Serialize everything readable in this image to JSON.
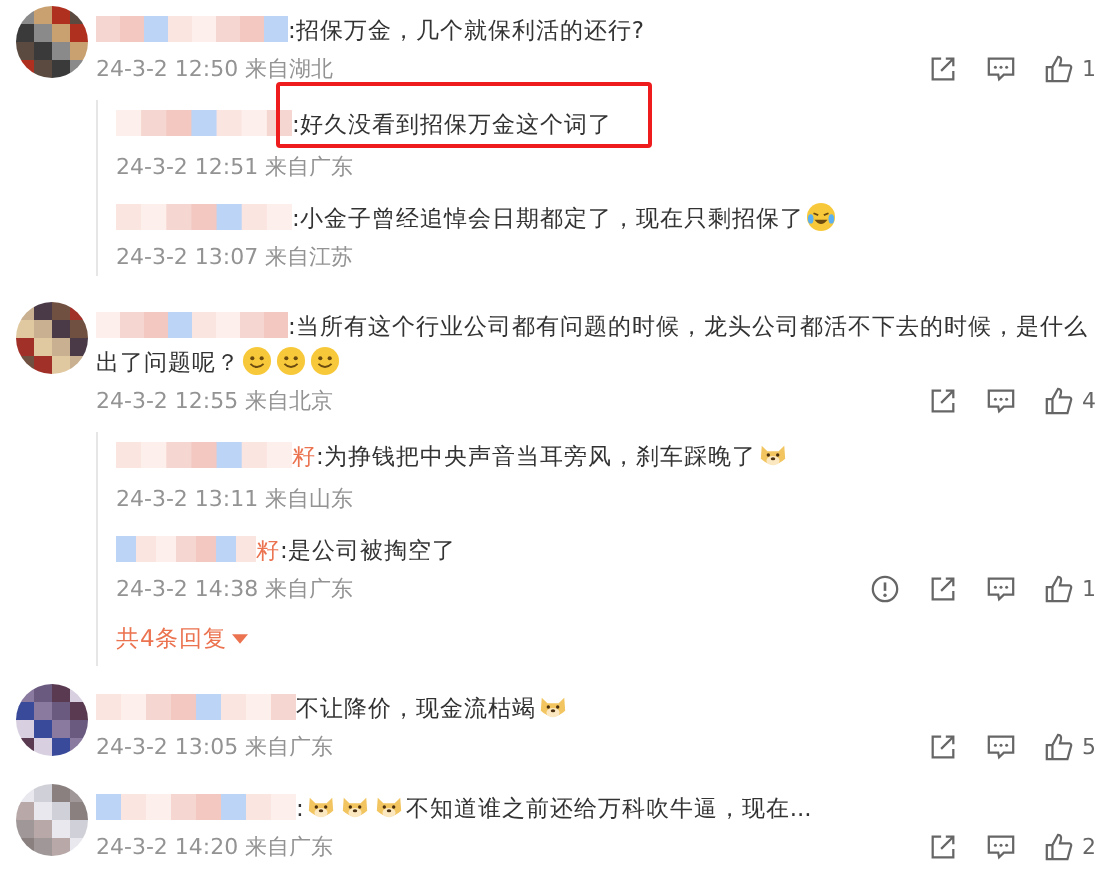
{
  "comments": [
    {
      "content": [
        {
          "kind": "text",
          "text": ":招保万金，几个就保利活的还行?"
        }
      ],
      "time": "24-3-2 12:50 来自湖北",
      "actions": [
        {
          "kind": "share"
        },
        {
          "kind": "comment"
        },
        {
          "kind": "like"
        }
      ],
      "likes": "1",
      "replies": [
        {
          "content": [
            {
              "kind": "text",
              "text": ":好久没看到招保万金这个词了"
            }
          ],
          "highlighted": true,
          "time": "24-3-2 12:51 来自广东"
        },
        {
          "content": [
            {
              "kind": "text",
              "text": ":小金子曾经追悼会日期都定了，现在只剩招保了"
            },
            {
              "kind": "crying"
            }
          ],
          "highlighted": false,
          "time": "24-3-2 13:07 来自江苏"
        }
      ]
    },
    {
      "content": [
        {
          "kind": "text",
          "text": ":当所有这个行业公司都有问题的时候，龙头公司都活不下去的时候，是什么"
        },
        {
          "kind": "break"
        },
        {
          "kind": "text",
          "text": "出了问题呢？"
        },
        {
          "kind": "smiley"
        },
        {
          "kind": "smiley"
        },
        {
          "kind": "smiley"
        }
      ],
      "time": "24-3-2 12:55 来自北京",
      "actions": [
        {
          "kind": "share"
        },
        {
          "kind": "comment"
        },
        {
          "kind": "like"
        }
      ],
      "likes": "4",
      "replies": [
        {
          "name_tail": "籽",
          "content": [
            {
              "kind": "text",
              "text": ":为挣钱把中央声音当耳旁风，刹车踩晚了"
            },
            {
              "kind": "doge"
            }
          ],
          "highlighted": false,
          "time": "24-3-2 13:11 来自山东"
        },
        {
          "name_tail": "籽",
          "content": [
            {
              "kind": "text",
              "text": ":是公司被掏空了"
            }
          ],
          "highlighted": false,
          "time": "24-3-2 14:38 来自广东",
          "actions": [
            {
              "kind": "report"
            },
            {
              "kind": "share"
            },
            {
              "kind": "comment"
            },
            {
              "kind": "like"
            }
          ],
          "likes": "1"
        }
      ],
      "more_replies": "共4条回复"
    },
    {
      "content": [
        {
          "kind": "text",
          "text": "不让降价，现金流枯竭"
        },
        {
          "kind": "doge"
        }
      ],
      "time": "24-3-2 13:05 来自广东",
      "actions": [
        {
          "kind": "share"
        },
        {
          "kind": "comment"
        },
        {
          "kind": "like"
        }
      ],
      "likes": "5"
    },
    {
      "content": [
        {
          "kind": "text",
          "text": ":"
        },
        {
          "kind": "doge"
        },
        {
          "kind": "doge"
        },
        {
          "kind": "doge"
        },
        {
          "kind": "text",
          "text": "不知道谁之前还给万科吹牛逼，现在..."
        }
      ],
      "time": "24-3-2 14:20 来自广东",
      "actions": [
        {
          "kind": "share"
        },
        {
          "kind": "comment"
        },
        {
          "kind": "like"
        }
      ],
      "likes": "2"
    }
  ]
}
